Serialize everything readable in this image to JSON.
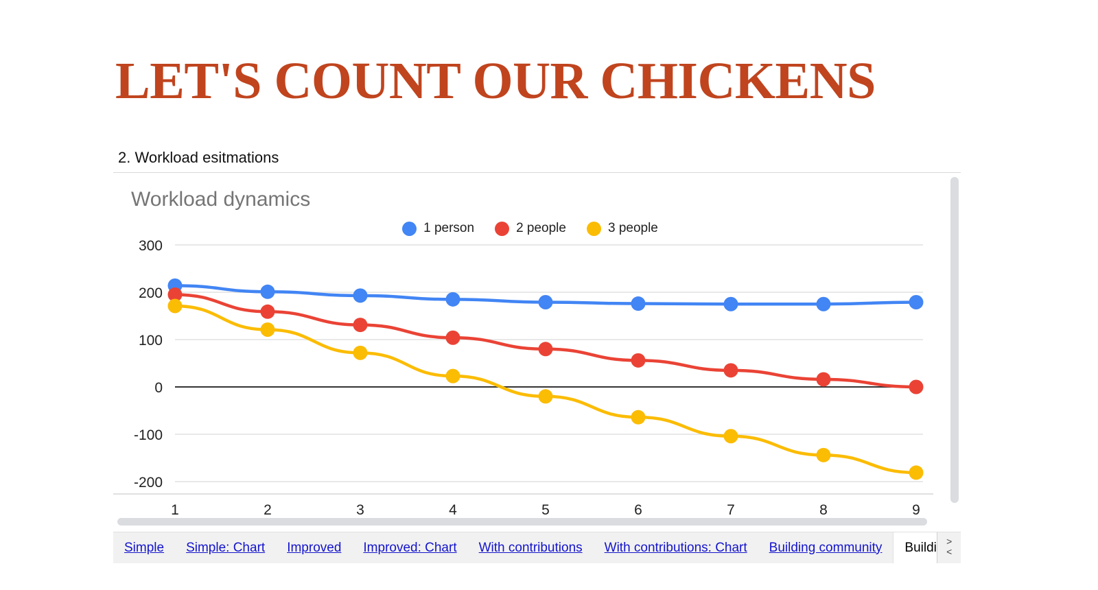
{
  "slide": {
    "title": "LET'S COUNT OUR CHICKENS",
    "title_color": "#C0441E",
    "section_caption": "2. Workload esitmations"
  },
  "chart_data": {
    "type": "line",
    "title": "Workload dynamics",
    "title_color": "#757575",
    "xlabel": "",
    "ylabel": "",
    "categories": [
      "1",
      "2",
      "3",
      "4",
      "5",
      "6",
      "7",
      "8",
      "9"
    ],
    "x": [
      1,
      2,
      3,
      4,
      5,
      6,
      7,
      8,
      9
    ],
    "ylim": [
      -200,
      300
    ],
    "yticks": [
      300,
      200,
      100,
      0,
      -100,
      -200
    ],
    "ytick_labels": [
      "300",
      "200",
      "100",
      "0",
      "-100",
      "-200"
    ],
    "grid": true,
    "legend_position": "top-center",
    "zero_line": true,
    "series": [
      {
        "name": "1 person",
        "color": "#4285F4",
        "values": [
          214,
          201,
          193,
          185,
          179,
          176,
          175,
          175,
          179
        ]
      },
      {
        "name": "2 people",
        "color": "#EA4335",
        "values": [
          195,
          159,
          131,
          104,
          80,
          56,
          35,
          16,
          0
        ]
      },
      {
        "name": "3 people",
        "color": "#FBBC04",
        "values": [
          171,
          121,
          72,
          23,
          -20,
          -64,
          -104,
          -144,
          -181
        ]
      }
    ]
  },
  "tabbar": {
    "tabs": [
      {
        "label": "Simple",
        "active": false
      },
      {
        "label": "Simple: Chart",
        "active": false
      },
      {
        "label": "Improved",
        "active": false
      },
      {
        "label": "Improved: Chart",
        "active": false
      },
      {
        "label": "With contributions",
        "active": false
      },
      {
        "label": "With contributions: Chart",
        "active": false
      },
      {
        "label": "Building community",
        "active": false
      },
      {
        "label": "Building community: Chart",
        "active": true
      }
    ],
    "scroll_next": ">",
    "scroll_prev": "<"
  }
}
